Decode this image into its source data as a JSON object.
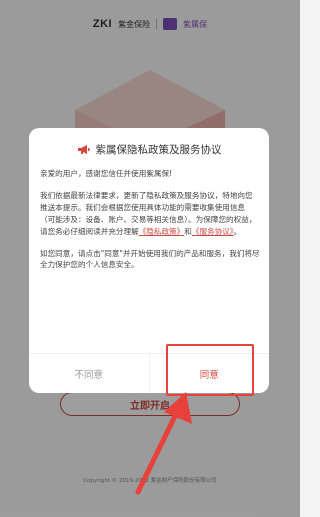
{
  "background": {
    "brand_logo": "ZKI",
    "brand_name": "紫金保险",
    "brand_sub": "紫属保",
    "start_button": "立即开启",
    "copyright": "Copyright © 2019-2022 紫金财产保险股份有限公司"
  },
  "dialog": {
    "title": "紫属保隐私政策及服务协议",
    "greeting": "亲爱的用户，感谢您信任并使用紫属保!",
    "para2_before": "我们依据最新法律要求，更新了隐私政策及服务协议，特地向您推送本提示。我们会根据您使用具体功能的需要收集使用信息（可能涉及：设备、账户、交易等相关信息）。为保障您的权益，请您务必仔细阅读并充分理解",
    "privacy_link": "《隐私政策》",
    "and_text": "和",
    "service_link": "《服务协议》",
    "para2_end": "。",
    "para3": "如您同意，请点击\"同意\"并开始使用我们的产品和服务，我们将尽全力保护您的个人信息安全。",
    "disagree_label": "不同意",
    "agree_label": "同意"
  },
  "colors": {
    "accent": "#d4483f",
    "highlight": "#e8403a",
    "brand_purple": "#7a4fb8"
  }
}
